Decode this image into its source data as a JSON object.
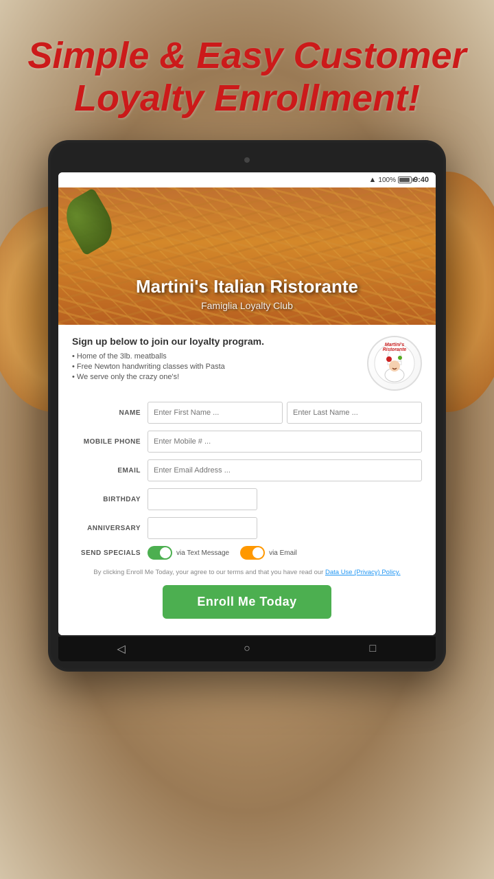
{
  "page": {
    "headline": "Simple & Easy Customer Loyalty Enrollment!",
    "background_color": "#c8a882"
  },
  "tablet": {
    "status_bar": {
      "time": "9:40",
      "battery": "100%"
    },
    "nav_buttons": {
      "back": "◁",
      "home": "○",
      "recent": "□"
    }
  },
  "restaurant": {
    "name": "Martini's Italian Ristorante",
    "subtitle": "Famiglia Loyalty Club",
    "logo_text": "Martini's Ristorante"
  },
  "form": {
    "signup_title": "Sign up below to join our loyalty program.",
    "bullets": [
      "Home of the 3lb. meatballs",
      "Free Newton handwriting classes with Pasta",
      "We serve only the crazy one's!"
    ],
    "fields": {
      "name_label": "NAME",
      "first_name_placeholder": "Enter First Name ...",
      "last_name_placeholder": "Enter Last Name ...",
      "mobile_label": "MOBILE PHONE",
      "mobile_placeholder": "Enter Mobile # ...",
      "email_label": "EMAIL",
      "email_placeholder": "Enter Email Address ...",
      "birthday_label": "BIRTHDAY",
      "anniversary_label": "ANNIVERSARY"
    },
    "send_specials": {
      "label": "SEND SPECIALS",
      "text_toggle_label": "via Text Message",
      "email_toggle_label": "via Email"
    },
    "terms_text": "By clicking Enroll Me Today, your agree to our terms and that you have read our",
    "terms_link": "Data Use (Privacy) Policy.",
    "enroll_button": "Enroll Me Today"
  }
}
